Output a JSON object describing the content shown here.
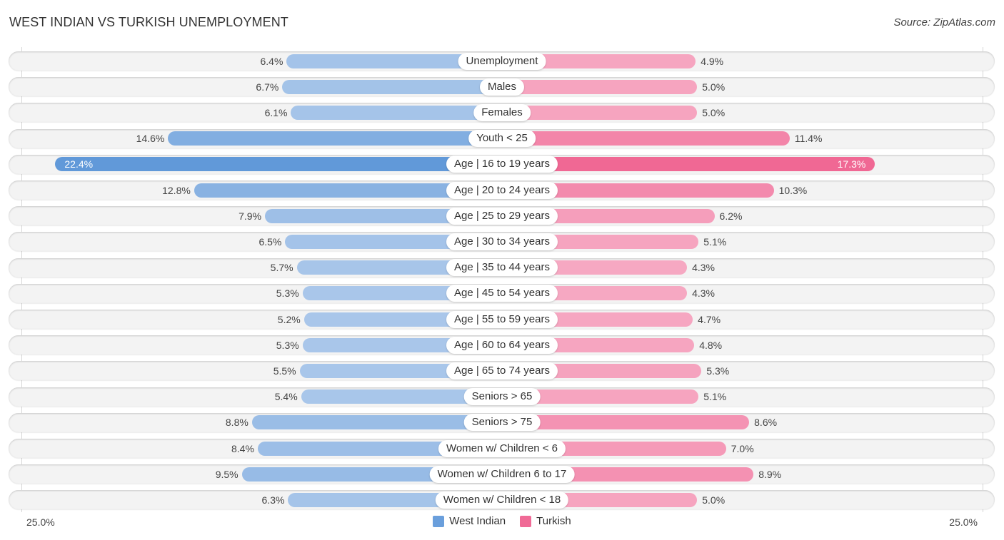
{
  "header": {
    "title": "WEST INDIAN VS TURKISH UNEMPLOYMENT",
    "source": "Source: ZipAtlas.com"
  },
  "colors": {
    "west_indian_light": "#aac7ea",
    "west_indian_strong": "#6199d9",
    "turkish_light": "#f6a9c3",
    "turkish_strong": "#f06894",
    "legend_west_indian": "#6a9fdc",
    "legend_turkish": "#f06a96"
  },
  "chart_data": {
    "type": "bar",
    "orientation": "horizontal-diverging",
    "title": "WEST INDIAN VS TURKISH UNEMPLOYMENT",
    "xlabel": "",
    "ylabel": "",
    "axis_left_label": "25.0%",
    "axis_right_label": "25.0%",
    "xlim": [
      0,
      25.0
    ],
    "grid": false,
    "legend_position": "bottom-center",
    "categories": [
      "Unemployment",
      "Males",
      "Females",
      "Youth < 25",
      "Age | 16 to 19 years",
      "Age | 20 to 24 years",
      "Age | 25 to 29 years",
      "Age | 30 to 34 years",
      "Age | 35 to 44 years",
      "Age | 45 to 54 years",
      "Age | 55 to 59 years",
      "Age | 60 to 64 years",
      "Age | 65 to 74 years",
      "Seniors > 65",
      "Seniors > 75",
      "Women w/ Children < 6",
      "Women w/ Children 6 to 17",
      "Women w/ Children < 18"
    ],
    "series": [
      {
        "name": "West Indian",
        "side": "left",
        "values": [
          6.4,
          6.7,
          6.1,
          14.6,
          22.4,
          12.8,
          7.9,
          6.5,
          5.7,
          5.3,
          5.2,
          5.3,
          5.5,
          5.4,
          8.8,
          8.4,
          9.5,
          6.3
        ],
        "labels": [
          "6.4%",
          "6.7%",
          "6.1%",
          "14.6%",
          "22.4%",
          "12.8%",
          "7.9%",
          "6.5%",
          "5.7%",
          "5.3%",
          "5.2%",
          "5.3%",
          "5.5%",
          "5.4%",
          "8.8%",
          "8.4%",
          "9.5%",
          "6.3%"
        ]
      },
      {
        "name": "Turkish",
        "side": "right",
        "values": [
          4.9,
          5.0,
          5.0,
          11.4,
          17.3,
          10.3,
          6.2,
          5.1,
          4.3,
          4.3,
          4.7,
          4.8,
          5.3,
          5.1,
          8.6,
          7.0,
          8.9,
          5.0
        ],
        "labels": [
          "4.9%",
          "5.0%",
          "5.0%",
          "11.4%",
          "17.3%",
          "10.3%",
          "6.2%",
          "5.1%",
          "4.3%",
          "4.3%",
          "4.7%",
          "4.8%",
          "5.3%",
          "5.1%",
          "8.6%",
          "7.0%",
          "8.9%",
          "5.0%"
        ]
      }
    ]
  },
  "legend": {
    "items": [
      {
        "label": "West Indian"
      },
      {
        "label": "Turkish"
      }
    ]
  }
}
